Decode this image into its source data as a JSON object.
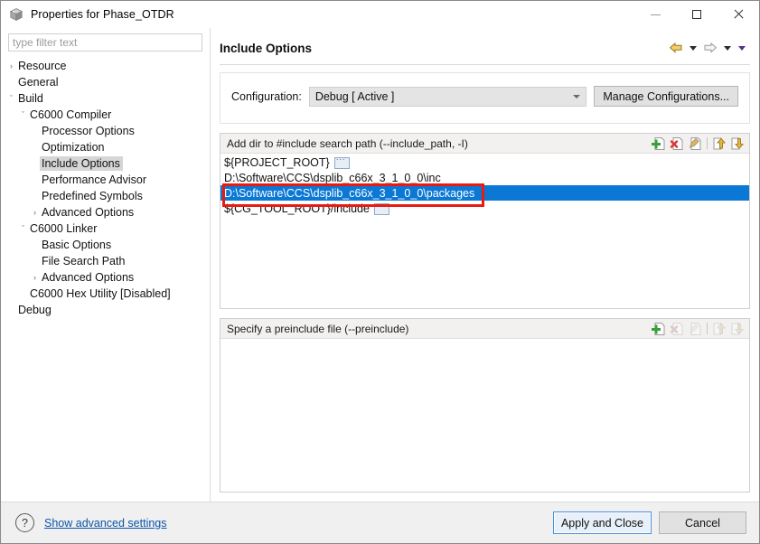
{
  "window": {
    "title": "Properties for Phase_OTDR",
    "icon": "cube-icon",
    "controls": {
      "minimize": "minimize-icon",
      "maximize": "maximize-icon",
      "close": "close-icon"
    }
  },
  "sidebar": {
    "filter": {
      "value": "",
      "placeholder": "type filter text"
    },
    "items": [
      {
        "label": "Resource",
        "indent": 0,
        "arrow": "collapsed",
        "selected": false
      },
      {
        "label": "General",
        "indent": 0,
        "arrow": "none",
        "selected": false
      },
      {
        "label": "Build",
        "indent": 0,
        "arrow": "expanded",
        "selected": false
      },
      {
        "label": "C6000 Compiler",
        "indent": 1,
        "arrow": "expanded",
        "selected": false
      },
      {
        "label": "Processor Options",
        "indent": 2,
        "arrow": "none",
        "selected": false
      },
      {
        "label": "Optimization",
        "indent": 2,
        "arrow": "none",
        "selected": false
      },
      {
        "label": "Include Options",
        "indent": 2,
        "arrow": "none",
        "selected": true
      },
      {
        "label": "Performance Advisor",
        "indent": 2,
        "arrow": "none",
        "selected": false
      },
      {
        "label": "Predefined Symbols",
        "indent": 2,
        "arrow": "none",
        "selected": false
      },
      {
        "label": "Advanced Options",
        "indent": 2,
        "arrow": "collapsed",
        "selected": false
      },
      {
        "label": "C6000 Linker",
        "indent": 1,
        "arrow": "expanded",
        "selected": false
      },
      {
        "label": "Basic Options",
        "indent": 2,
        "arrow": "none",
        "selected": false
      },
      {
        "label": "File Search Path",
        "indent": 2,
        "arrow": "none",
        "selected": false
      },
      {
        "label": "Advanced Options",
        "indent": 2,
        "arrow": "collapsed",
        "selected": false
      },
      {
        "label": "C6000 Hex Utility  [Disabled]",
        "indent": 1,
        "arrow": "none",
        "selected": false
      },
      {
        "label": "Debug",
        "indent": 0,
        "arrow": "none",
        "selected": false
      }
    ]
  },
  "page": {
    "title": "Include Options",
    "nav": {
      "back": "back-arrow-icon",
      "back_menu": "back-dropdown-icon",
      "forward": "forward-arrow-icon",
      "forward_menu": "forward-dropdown-icon",
      "view_menu": "view-menu-icon"
    }
  },
  "configuration": {
    "label": "Configuration:",
    "selected": "Debug  [ Active ]",
    "options": [
      "Debug  [ Active ]"
    ],
    "manage_button": "Manage Configurations..."
  },
  "include_paths": {
    "header": "Add dir to #include search path (--include_path, -I)",
    "tools": [
      {
        "name": "add-icon",
        "enabled": true
      },
      {
        "name": "delete-icon",
        "enabled": true
      },
      {
        "name": "edit-icon",
        "enabled": true
      },
      {
        "name": "move-up-icon",
        "enabled": true
      },
      {
        "name": "move-down-icon",
        "enabled": true
      }
    ],
    "rows": [
      {
        "text": "${PROJECT_ROOT}",
        "browse": true,
        "selected": false
      },
      {
        "text": "D:\\Software\\CCS\\dsplib_c66x_3_1_0_0\\inc",
        "browse": false,
        "selected": false
      },
      {
        "text": "D:\\Software\\CCS\\dsplib_c66x_3_1_0_0\\packages",
        "browse": false,
        "selected": true
      },
      {
        "text": "${CG_TOOL_ROOT}/include",
        "browse": true,
        "selected": false
      }
    ]
  },
  "preinclude": {
    "header": "Specify a preinclude file (--preinclude)",
    "tools": [
      {
        "name": "add-icon",
        "enabled": true
      },
      {
        "name": "delete-icon",
        "enabled": false
      },
      {
        "name": "edit-icon",
        "enabled": false
      },
      {
        "name": "move-up-icon",
        "enabled": false
      },
      {
        "name": "move-down-icon",
        "enabled": false
      }
    ],
    "rows": []
  },
  "footer": {
    "help": "?",
    "advanced_link": "Show advanced settings",
    "apply_button": "Apply and Close",
    "cancel_button": "Cancel"
  },
  "annotation": {
    "color": "#e81b13",
    "target_row": "D:\\Software\\CCS\\dsplib_c66x_3_1_0_0\\packages"
  },
  "colors": {
    "selection_blue": "#0a78d4",
    "annotation_red": "#e81b13",
    "link_blue": "#0b55a8"
  }
}
